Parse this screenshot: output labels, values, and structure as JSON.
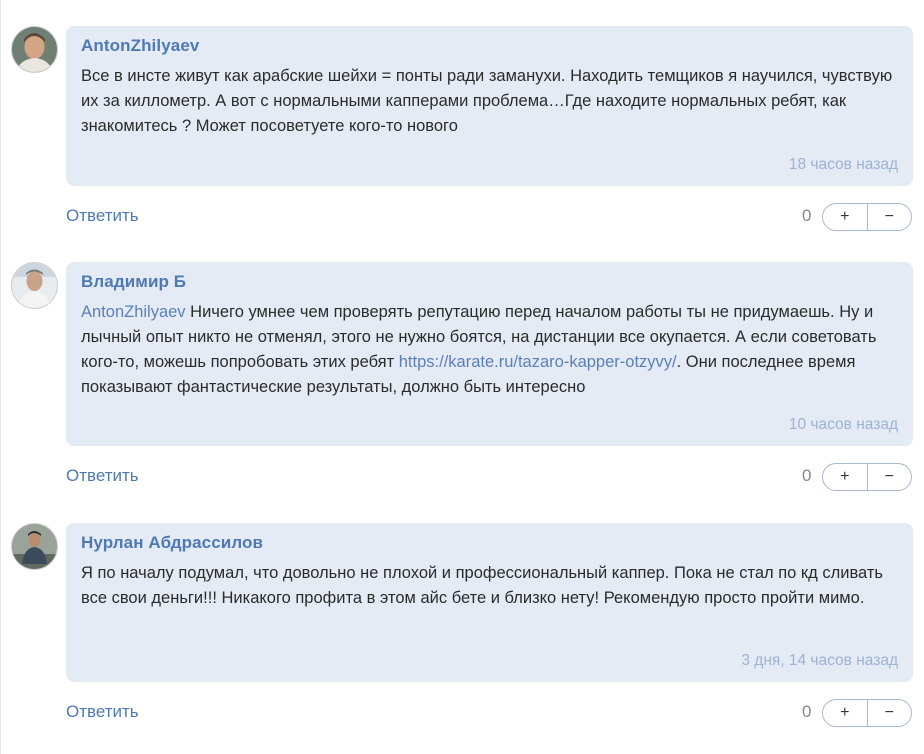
{
  "comments": [
    {
      "author": "AntonZhilyaev",
      "text": "Все в инсте живут как арабские шейхи = понты ради заманухи. Находить темщиков я научился, чувствую их за киллометр. А вот с нормальными капперами проблема…Где находите нормальных ребят, как знакомитесь ? Может посоветуете кого-то нового",
      "time": "18 часов назад",
      "reply": "Ответить",
      "score": "0",
      "plus": "+",
      "minus": "−"
    },
    {
      "author": "Владимир Б",
      "mention": "AntonZhilyaev",
      "text_part1": " Ничего умнее чем проверять репутацию перед началом работы ты не придумаешь. Ну и лычный опыт никто не отменял, этого не нужно боятся, на дистанции все окупается. А если советовать кого-то, можешь попробовать этих ребят ",
      "link": "https://karate.ru/tazaro-kapper-otzyvy/",
      "text_part2": ". Они последнее время показывают фантастические результаты, должно быть интересно",
      "time": "10 часов назад",
      "reply": "Ответить",
      "score": "0",
      "plus": "+",
      "minus": "−"
    },
    {
      "author": "Нурлан Абдрассилов",
      "text": "Я по началу подумал, что довольно не плохой и профессиональный каппер. Пока не стал по кд сливать все свои деньги!!! Никакого профита в этом айс бете и близко нету! Рекомендую просто пройти мимо.",
      "time": "3 дня, 14 часов назад",
      "reply": "Ответить",
      "score": "0",
      "plus": "+",
      "minus": "−"
    }
  ]
}
